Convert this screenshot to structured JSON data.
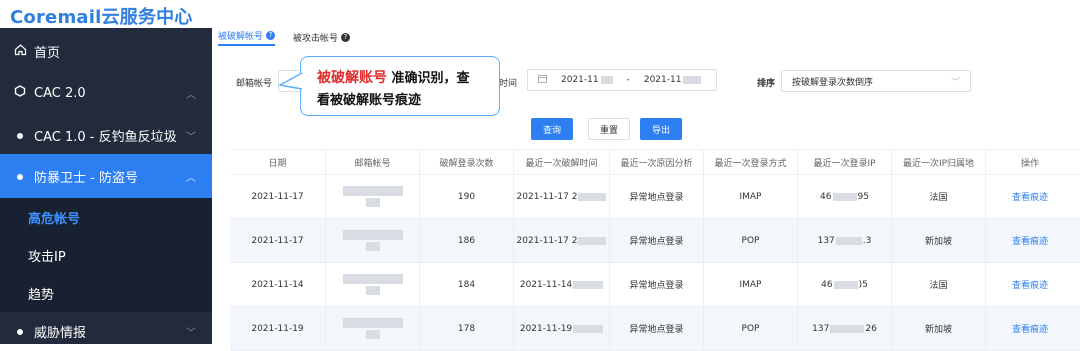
{
  "app": {
    "title": "Coremail云服务中心"
  },
  "sidebar": {
    "items": [
      {
        "icon": "home-icon",
        "label": "首页"
      },
      {
        "icon": "hexagon-icon",
        "label": "CAC 2.0"
      },
      {
        "icon": "dot-icon",
        "label": "CAC 1.0 - 反钓鱼反垃圾"
      },
      {
        "icon": "dot-icon",
        "label": "防暴卫士 - 防盗号"
      },
      {
        "icon": "dot-icon",
        "label": "威胁情报"
      }
    ],
    "subitems": [
      {
        "label": "高危帐号"
      },
      {
        "label": "攻击IP"
      },
      {
        "label": "趋势"
      }
    ]
  },
  "tabs": [
    {
      "label": "被破解帐号",
      "active": true
    },
    {
      "label": "被攻击帐号",
      "active": false
    }
  ],
  "filters": {
    "email_label": "邮箱帐号",
    "time_label": "查询时间",
    "date_start": "2021-11",
    "date_sep": "-",
    "date_end": "2021-11",
    "sort_label": "排序",
    "sort_value": "按破解登录次数倒序"
  },
  "callout": {
    "highlight": "被破解账号",
    "text1": " 准确识别，查",
    "text2": "看被破解账号痕迹"
  },
  "buttons": {
    "query": "查询",
    "reset": "重置",
    "export": "导出"
  },
  "table": {
    "headers": [
      "日期",
      "邮箱帐号",
      "破解登录次数",
      "最近一次破解时间",
      "最近一次原因分析",
      "最近一次登录方式",
      "最近一次登录IP",
      "最近一次IP归属地",
      "操作"
    ],
    "rows": [
      {
        "date": "2021-11-17",
        "count": "190",
        "time": "2021-11-17 2",
        "reason": "异常地点登录",
        "method": "IMAP",
        "ip_start": "46",
        "ip_end": "95",
        "location": "法国",
        "action": "查看痕迹"
      },
      {
        "date": "2021-11-17",
        "count": "186",
        "time": "2021-11-17 2",
        "reason": "异常地点登录",
        "method": "POP",
        "ip_start": "137",
        "ip_end": ".3",
        "location": "新加坡",
        "action": "查看痕迹"
      },
      {
        "date": "2021-11-14",
        "count": "184",
        "time": "2021-11-14",
        "reason": "异常地点登录",
        "method": "IMAP",
        "ip_start": "46",
        "ip_end": ")5",
        "location": "法国",
        "action": "查看痕迹"
      },
      {
        "date": "2021-11-19",
        "count": "178",
        "time": "2021-11-19",
        "reason": "异常地点登录",
        "method": "POP",
        "ip_start": "137",
        "ip_end": "26",
        "location": "新加坡",
        "action": "查看痕迹"
      }
    ]
  }
}
